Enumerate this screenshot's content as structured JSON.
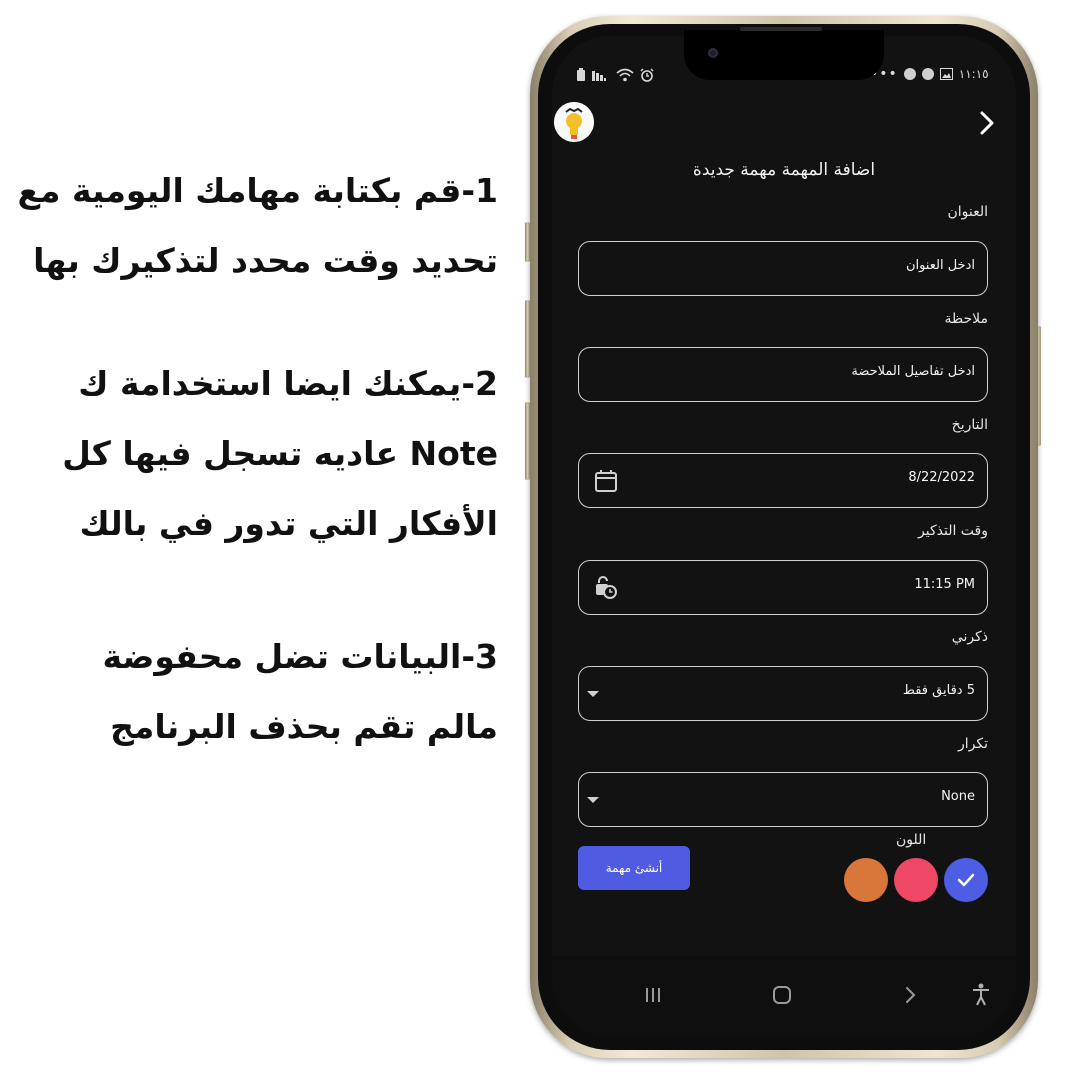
{
  "promo": {
    "lines": [
      "1-قم بكتابة مهامك اليومية مع",
      "تحديد وقت محدد لتذكيرك بها",
      "2-يمكنك ايضا استخدامة ك",
      "Note عاديه تسجل فيها كل",
      "الأفكار التي تدور في بالك",
      "3-البيانات تضل محفوضة",
      "مالم تقم بحذف البرنامج"
    ]
  },
  "statusbar": {
    "time": "١١:١٥",
    "left_icons": [
      "battery-icon",
      "signal-icon",
      "wifi-icon",
      "alarm-icon"
    ],
    "right_icons": [
      "more-dots-icon",
      "app-notification-icon",
      "whatsapp-icon",
      "gallery-icon"
    ]
  },
  "app": {
    "title": "اضافة المهمة مهمة جديدة",
    "back_icon": "chevron-right-icon",
    "avatar_icon": "lightbulb-avatar-icon"
  },
  "form": {
    "title_label": "العنوان",
    "title_placeholder": "ادخل العنوان",
    "note_label": "ملاحظة",
    "note_placeholder": "ادخل تفاصيل الملاحضة",
    "date_label": "التاريخ",
    "date_value": "8/22/2022",
    "time_label": "وقت التذكير",
    "time_value": "11:15 PM",
    "remind_label": "ذكرني",
    "remind_value": "5  دقايق فقط",
    "repeat_label": "تكرار",
    "repeat_value": "None",
    "color_label": "اللون",
    "create_button": "أنشئ مهمة",
    "colors": [
      "#4e5ee4",
      "#ef4866",
      "#d9773a"
    ],
    "selected_color_index": 0
  },
  "navbar": {
    "icons": [
      "recent-apps-icon",
      "home-icon",
      "back-icon",
      "accessibility-icon"
    ]
  }
}
